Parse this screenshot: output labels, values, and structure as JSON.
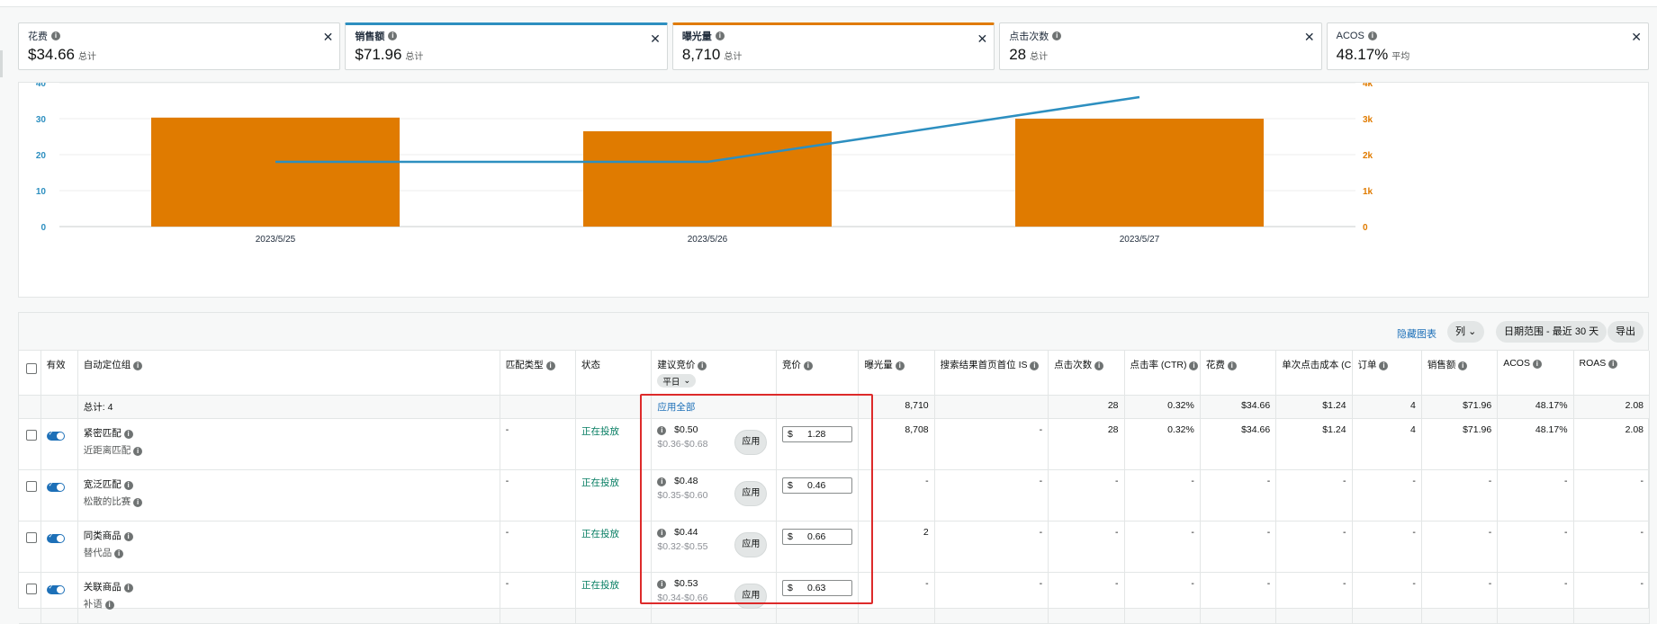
{
  "metrics": [
    {
      "label": "花费",
      "value": "$34.66",
      "sub": "总计",
      "selected": null
    },
    {
      "label": "销售额",
      "value": "$71.96",
      "sub": "总计",
      "selected": "#2d8fc0"
    },
    {
      "label": "曝光量",
      "value": "8,710",
      "sub": "总计",
      "selected": "#e07b00"
    },
    {
      "label": "点击次数",
      "value": "28",
      "sub": "总计",
      "selected": null
    },
    {
      "label": "ACOS",
      "value": "48.17%",
      "sub": "平均",
      "selected": null
    }
  ],
  "chart_data": {
    "type": "bar",
    "categories": [
      "2023/5/25",
      "2023/5/26",
      "2023/5/27"
    ],
    "series": [
      {
        "type": "bar",
        "axis": "right",
        "color": "#e07b00",
        "values": [
          3030,
          2650,
          3000
        ]
      },
      {
        "type": "line",
        "axis": "left",
        "color": "#2d8fc0",
        "values": [
          18,
          18,
          36
        ]
      }
    ],
    "left_axis": {
      "ticks": [
        "0",
        "10",
        "20",
        "30",
        "40"
      ],
      "range": [
        0,
        40
      ],
      "color": "#2d8fc0"
    },
    "right_axis": {
      "ticks": [
        "0",
        "1k",
        "2k",
        "3k",
        "4k"
      ],
      "range": [
        0,
        4000
      ],
      "color": "#e07b00"
    }
  },
  "toolbar": {
    "hide_chart": "隐藏图表",
    "columns": "列",
    "date_range": "日期范围 - 最近 30 天",
    "export": "导出"
  },
  "table": {
    "headers": {
      "active": "有效",
      "group": "自动定位组",
      "match": "匹配类型",
      "status": "状态",
      "suggested": "建议竞价",
      "weekday": "平日",
      "bid": "竞价",
      "impr": "曝光量",
      "topis": "搜索结果首页首位 IS",
      "clicks": "点击次数",
      "ctr": "点击率 (CTR)",
      "spend": "花费",
      "cpc": "单次点击成本 (CPC)",
      "orders": "订单",
      "sales": "销售额",
      "acos": "ACOS",
      "roas": "ROAS"
    },
    "total": {
      "label": "总计: 4",
      "apply_all": "应用全部",
      "impr": "8,710",
      "clicks": "28",
      "ctr": "0.32%",
      "spend": "$34.66",
      "cpc": "$1.24",
      "orders": "4",
      "sales": "$71.96",
      "acos": "48.17%",
      "roas": "2.08"
    },
    "apply_label": "应用",
    "currency": "$",
    "rows": [
      {
        "name": "紧密匹配",
        "sub": "近距离匹配",
        "match": "-",
        "status": "正在投放",
        "sugg": "$0.50",
        "range": "$0.36-$0.68",
        "bid": "1.28",
        "impr": "8,708",
        "topis": "-",
        "clicks": "28",
        "ctr": "0.32%",
        "spend": "$34.66",
        "cpc": "$1.24",
        "orders": "4",
        "sales": "$71.96",
        "acos": "48.17%",
        "roas": "2.08"
      },
      {
        "name": "宽泛匹配",
        "sub": "松散的比赛",
        "match": "-",
        "status": "正在投放",
        "sugg": "$0.48",
        "range": "$0.35-$0.60",
        "bid": "0.46",
        "impr": "-",
        "topis": "-",
        "clicks": "-",
        "ctr": "-",
        "spend": "-",
        "cpc": "-",
        "orders": "-",
        "sales": "-",
        "acos": "-",
        "roas": "-"
      },
      {
        "name": "同类商品",
        "sub": "替代品",
        "match": "-",
        "status": "正在投放",
        "sugg": "$0.44",
        "range": "$0.32-$0.55",
        "bid": "0.66",
        "impr": "2",
        "topis": "-",
        "clicks": "-",
        "ctr": "-",
        "spend": "-",
        "cpc": "-",
        "orders": "-",
        "sales": "-",
        "acos": "-",
        "roas": "-"
      },
      {
        "name": "关联商品",
        "sub": "补语",
        "match": "-",
        "status": "正在投放",
        "sugg": "$0.53",
        "range": "$0.34-$0.66",
        "bid": "0.63",
        "impr": "-",
        "topis": "-",
        "clicks": "-",
        "ctr": "-",
        "spend": "-",
        "cpc": "-",
        "orders": "-",
        "sales": "-",
        "acos": "-",
        "roas": "-"
      }
    ]
  }
}
